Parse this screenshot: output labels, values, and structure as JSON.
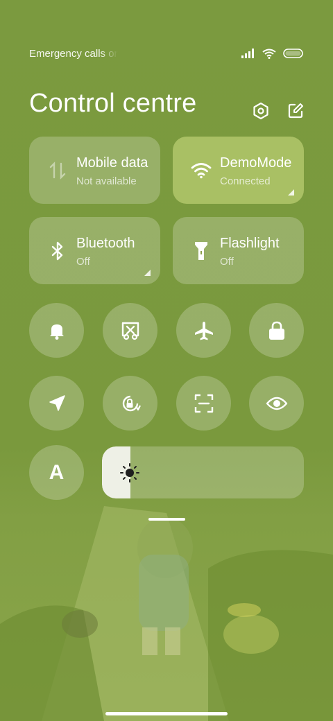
{
  "status_bar": {
    "carrier_text": "Emergency calls only",
    "icons": [
      "signal-icon",
      "wifi-icon",
      "battery-icon"
    ]
  },
  "header": {
    "title": "Control centre",
    "actions": [
      "settings-icon",
      "edit-icon"
    ]
  },
  "tiles": [
    {
      "id": "mobile-data",
      "label": "Mobile data",
      "state": "Not available",
      "icon": "mobile-data-icon",
      "active": false
    },
    {
      "id": "wifi",
      "label": "DemoMode",
      "state": "Connected",
      "icon": "wifi-icon",
      "active": true
    },
    {
      "id": "bluetooth",
      "label": "Bluetooth",
      "state": "Off",
      "icon": "bluetooth-icon",
      "active": false
    },
    {
      "id": "flashlight",
      "label": "Flashlight",
      "state": "Off",
      "icon": "flashlight-icon",
      "active": false
    }
  ],
  "toggles_row1": [
    "bell-icon",
    "screen-cast-icon",
    "airplane-icon",
    "lock-icon"
  ],
  "toggles_row2": [
    "location-icon",
    "auto-rotate-icon",
    "scan-icon",
    "eye-icon"
  ],
  "auto_brightness": {
    "label": "A"
  },
  "brightness": {
    "level": 0.14
  },
  "colors": {
    "background": "#7a9a3e",
    "active_tile": "#a9c064",
    "inactive_tile": "rgba(255,255,255,0.22)",
    "slider_fill": "#eef0e6"
  }
}
